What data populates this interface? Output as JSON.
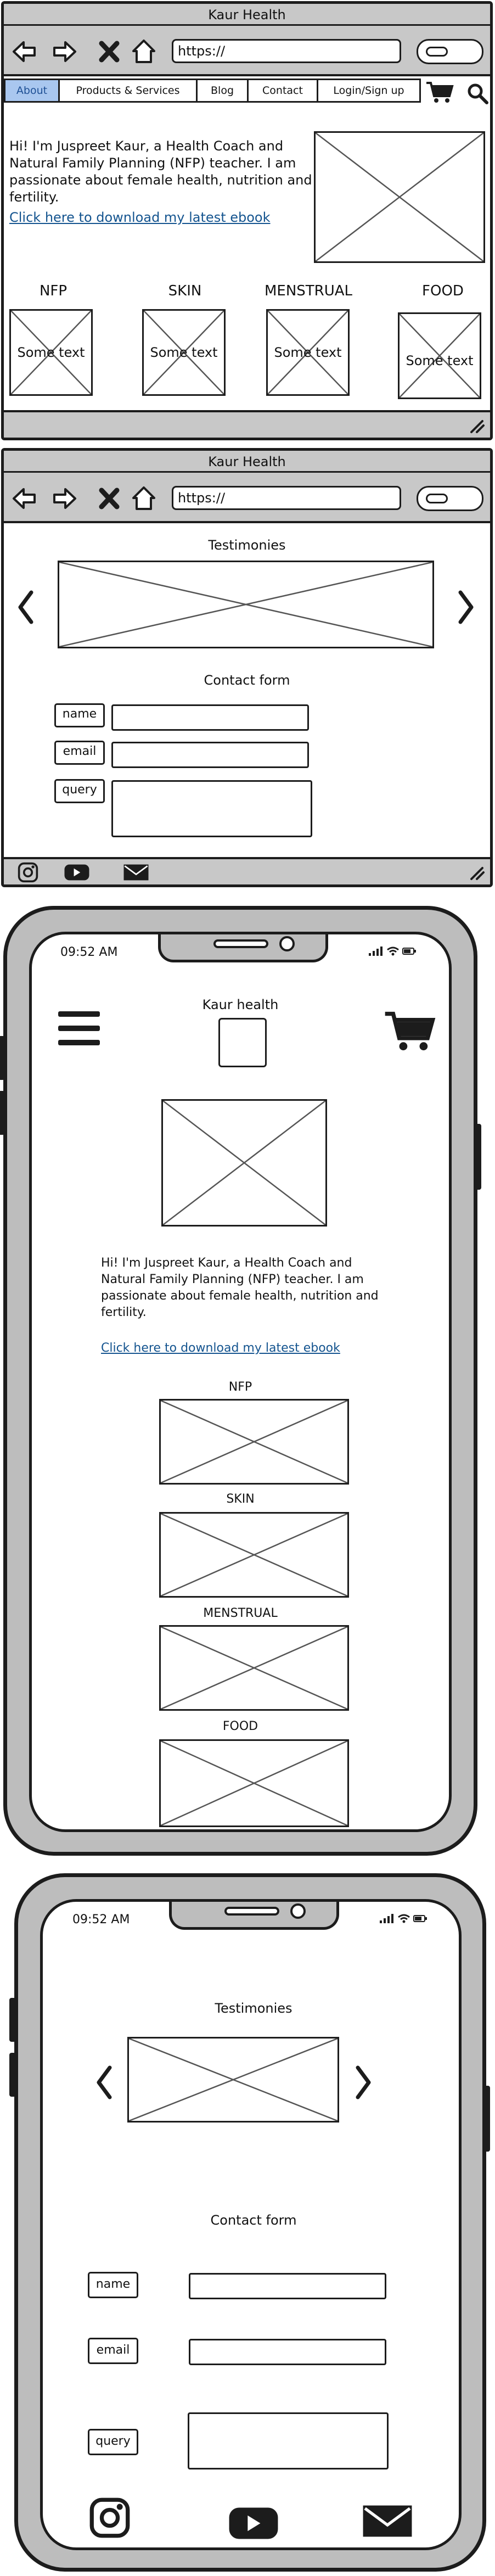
{
  "desktop_home": {
    "window_title": "Kaur Health",
    "url": "https://",
    "nav": [
      "About",
      "Products & Services",
      "Blog",
      "Contact",
      "Login/Sign up"
    ],
    "intro": "Hi! I'm Juspreet Kaur, a Health Coach and Natural Family Planning (NFP) teacher. I am passionate about female health, nutrition and fertility.",
    "ebook_link": "Click here to download my latest ebook",
    "categories": [
      {
        "title": "NFP",
        "caption": "Some text"
      },
      {
        "title": "SKIN",
        "caption": "Some text"
      },
      {
        "title": "MENSTRUAL",
        "caption": "Some text"
      },
      {
        "title": "FOOD",
        "caption": "Some text"
      }
    ]
  },
  "desktop_contact": {
    "window_title": "Kaur Health",
    "url": "https://",
    "testimonies_title": "Testimonies",
    "contact_title": "Contact form",
    "fields": [
      "name",
      "email",
      "query"
    ],
    "social_icons": [
      "instagram-icon",
      "youtube-icon",
      "email-icon"
    ]
  },
  "mobile_home": {
    "time": "09:52 AM",
    "site_title": "Kaur health",
    "intro": "Hi! I'm Juspreet Kaur, a Health Coach and Natural Family Planning (NFP) teacher. I am passionate about female health, nutrition and fertility.",
    "ebook_link": "Click here to download my latest ebook",
    "categories": [
      "NFP",
      "SKIN",
      "MENSTRUAL",
      "FOOD"
    ]
  },
  "mobile_contact": {
    "time": "09:52 AM",
    "testimonies_title": "Testimonies",
    "contact_title": "Contact form",
    "fields": [
      "name",
      "email",
      "query"
    ],
    "social_icons": [
      "instagram-icon",
      "youtube-icon",
      "email-icon"
    ]
  },
  "colors": {
    "active_tab": "#a9c7ef",
    "link": "#14548f",
    "chrome": "#c8c8c8",
    "outline": "#1c1c1c"
  }
}
